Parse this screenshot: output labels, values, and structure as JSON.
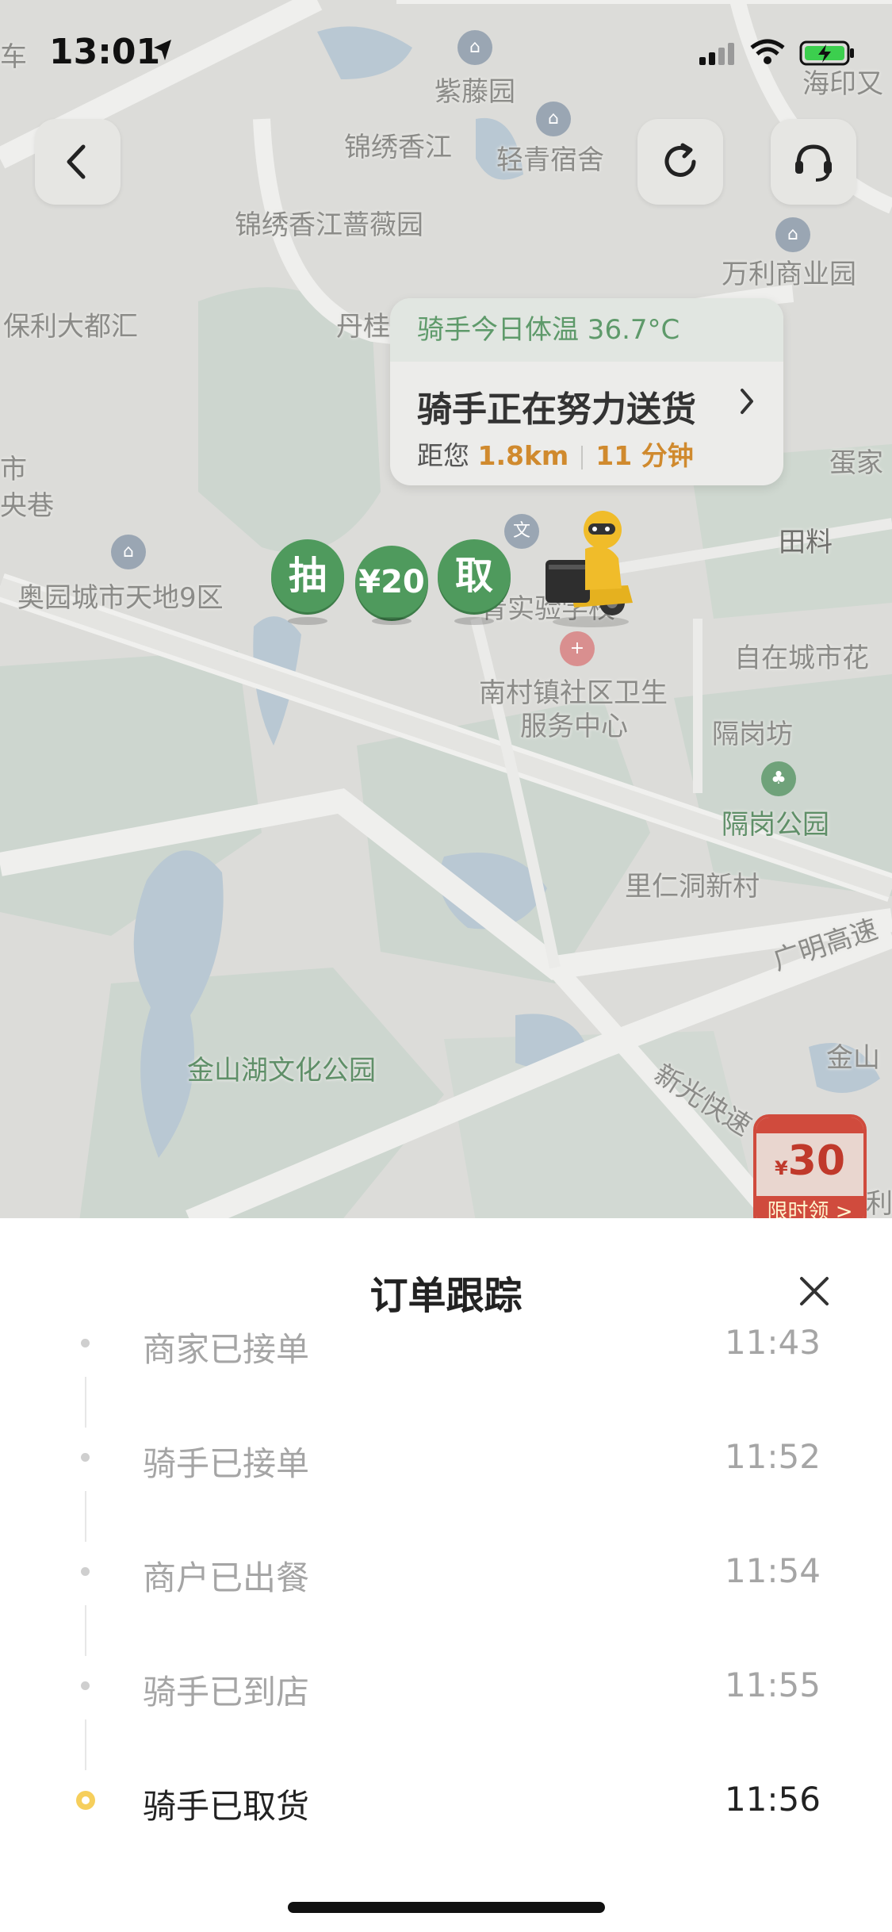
{
  "status_bar": {
    "time": "13:01"
  },
  "map": {
    "labels": [
      {
        "id": "map-label-car",
        "text": "车"
      },
      {
        "id": "map-label-zitengyuan",
        "text": "紫藤园"
      },
      {
        "id": "map-label-haiyin",
        "text": "海印又"
      },
      {
        "id": "map-label-jinxiu-xiangjiang",
        "text": "锦绣香江"
      },
      {
        "id": "map-label-qingqing-sushe",
        "text": "轻青宿舍"
      },
      {
        "id": "map-label-jinxiu-qiangwei",
        "text": "锦绣香江蔷薇园"
      },
      {
        "id": "map-label-wanli",
        "text": "万利商业园"
      },
      {
        "id": "map-label-baoli",
        "text": "保利大都汇"
      },
      {
        "id": "map-label-dangui",
        "text": "丹桂"
      },
      {
        "id": "map-label-jia",
        "text": "蛋家"
      },
      {
        "id": "map-label-shi",
        "text": "市"
      },
      {
        "id": "map-label-yangxiang",
        "text": "央巷"
      },
      {
        "id": "map-label-tianliao",
        "text": "田料"
      },
      {
        "id": "map-label-aoyuan",
        "text": "奥园城市天地9区"
      },
      {
        "id": "map-label-shiyan",
        "text": "青实验学校"
      },
      {
        "id": "map-label-zizai",
        "text": "自在城市花"
      },
      {
        "id": "map-label-nancun",
        "text": "南村镇社区卫生"
      },
      {
        "id": "map-label-fuwu",
        "text": "服务中心"
      },
      {
        "id": "map-label-gegangfang",
        "text": "隔岗坊"
      },
      {
        "id": "map-label-gegang-park",
        "text": "隔岗公园"
      },
      {
        "id": "map-label-lirendong",
        "text": "里仁洞新村"
      },
      {
        "id": "map-label-guangming",
        "text": "广明高速"
      },
      {
        "id": "map-label-jinshanhu",
        "text": "金山湖文化公园"
      },
      {
        "id": "map-label-jinshan",
        "text": "金山"
      },
      {
        "id": "map-label-xinguang",
        "text": "新光快速"
      },
      {
        "id": "map-label-li",
        "text": "利"
      }
    ]
  },
  "bubble": {
    "temperature": "骑手今日体温 36.7°C",
    "title": "骑手正在努力送货",
    "distance_prefix": "距您",
    "distance": "1.8km",
    "eta": "11 分钟"
  },
  "badges": [
    "抽",
    "¥20",
    "取"
  ],
  "promo": {
    "currency": "¥",
    "amount": "30",
    "label": "限时领 >"
  },
  "sheet": {
    "title": "订单跟踪",
    "timeline": [
      {
        "label": "商家已接单",
        "time": "11:43",
        "active": false
      },
      {
        "label": "骑手已接单",
        "time": "11:52",
        "active": false
      },
      {
        "label": "商户已出餐",
        "time": "11:54",
        "active": false
      },
      {
        "label": "骑手已到店",
        "time": "11:55",
        "active": false
      },
      {
        "label": "骑手已取货",
        "time": "11:56",
        "active": true
      }
    ]
  },
  "colors": {
    "map_bg": "#d9d9d6",
    "accent_green": "#4f9a5d",
    "highlight_orange": "#d08a2e",
    "active_dot": "#f6cf5c"
  }
}
